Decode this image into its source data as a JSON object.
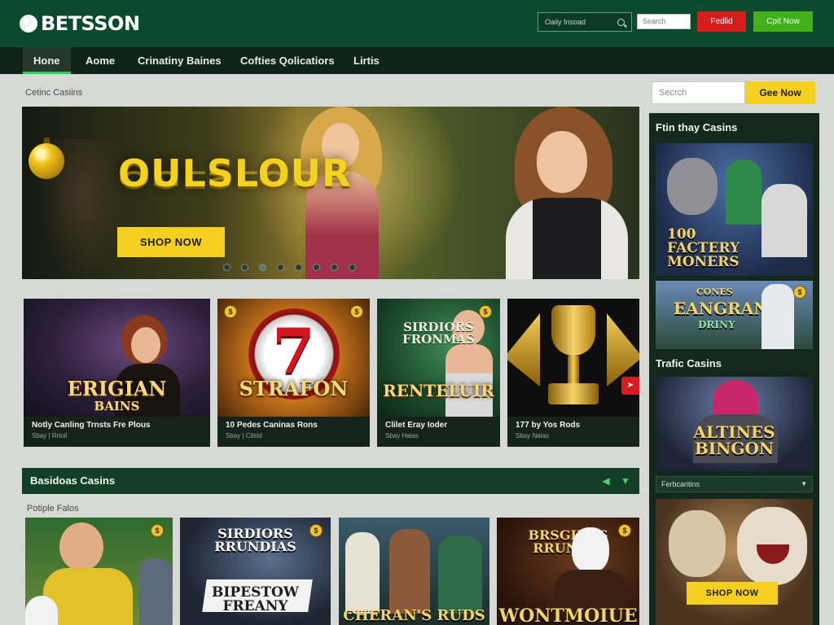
{
  "brand": {
    "name": "BETSSON"
  },
  "header": {
    "search_placeholder": "Oaiiy Insoad",
    "search_box_text": "Search",
    "btn_red_label": "Fedlid",
    "btn_green_label": "Cpit Now"
  },
  "nav": [
    {
      "label": "Hone",
      "active": true
    },
    {
      "label": "Aome",
      "active": false
    },
    {
      "label": "Crinatiny Baines",
      "active": false
    },
    {
      "label": "Cofties Qolicatiors",
      "active": false
    },
    {
      "label": "Lirtis",
      "active": false
    }
  ],
  "breadcrumb": "Cetinc Casiins",
  "hero": {
    "title": "OULSLOUR",
    "cta": "SHOP NOW",
    "slides_total": 8,
    "slide_active": 2
  },
  "tiles": [
    {
      "art_title": "ERIGIAN",
      "art_sub": "BAINS",
      "name": "Notly Canling Trnsts Fre Plous",
      "meta": "Sbay | Rrtoil"
    },
    {
      "art_title": "STRAFON",
      "art_sub": "",
      "name": "10 Pedes Caninas Rons",
      "meta": "Sbay | Cilstd"
    },
    {
      "art_title": "RENTELUIR",
      "art_sub": "",
      "art_top": "SIRDIORS FRONMAS",
      "name": "Clilet Eray Ioder",
      "meta": "Sbay Halas"
    },
    {
      "art_title": "",
      "art_sub": "",
      "name": "177 by Yos Rods",
      "meta": "Sbay Nalas"
    }
  ],
  "section": {
    "title": "Basidoas Casins",
    "sub_label": "Potiple Falos"
  },
  "row2": [
    {
      "title": ""
    },
    {
      "title_top": "SIRDIORS RRUNDIAS",
      "title": "BIPESTOW FREANY"
    },
    {
      "title": "CHERAN'S RUDS"
    },
    {
      "title_top": "BRSGINAS RRUNIAS",
      "title": "WONTMOIUE"
    }
  ],
  "sidebar": {
    "search_placeholder": "Secrch",
    "cta": "Gee Now",
    "head1": "Ftin thay Casins",
    "card1_title": "100 FACTERY MONERS",
    "card2_title_top": "CONES",
    "card2_title": "EANGRAN",
    "card2_sub": "DRINY",
    "head2": "Trafic Casins",
    "card3_title": "ALTINES BINGON",
    "select_value": "Ferbcaritins",
    "shop_cta": "SHOP NOW"
  },
  "colors": {
    "header_bg": "#0b4a2c",
    "accent_yellow": "#f5d020",
    "accent_green": "#42b01b",
    "accent_red": "#d61d1d"
  }
}
